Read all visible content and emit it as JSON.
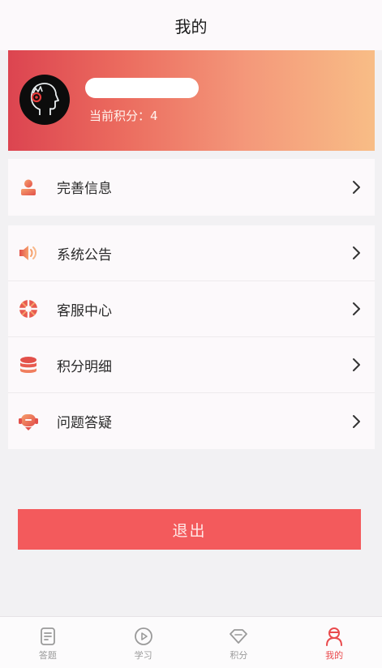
{
  "header": {
    "title": "我的"
  },
  "profile": {
    "points_text": "当前积分：4"
  },
  "menu_group1": [
    {
      "label": "完善信息",
      "icon": "user-icon"
    }
  ],
  "menu_group2": [
    {
      "label": "系统公告",
      "icon": "speaker-icon"
    },
    {
      "label": "客服中心",
      "icon": "support-icon"
    },
    {
      "label": "积分明细",
      "icon": "coins-icon"
    },
    {
      "label": "问题答疑",
      "icon": "headset-icon"
    }
  ],
  "logout_label": "退出",
  "tabs": [
    {
      "label": "答题",
      "icon": "document-icon",
      "active": false
    },
    {
      "label": "学习",
      "icon": "play-icon",
      "active": false
    },
    {
      "label": "积分",
      "icon": "diamond-icon",
      "active": false
    },
    {
      "label": "我的",
      "icon": "person-icon",
      "active": true
    }
  ],
  "colors": {
    "accent": "#f35a5c",
    "banner_start": "#dc4450",
    "banner_end": "#f8bd86",
    "active_tab": "#e94a4d"
  }
}
